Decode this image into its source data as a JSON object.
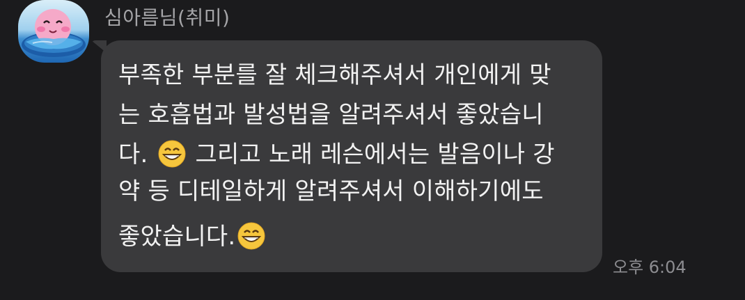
{
  "chat": {
    "sender_name": "심아름님(취미)",
    "message": {
      "line1": "부족한 부분를 잘 체크해주셔서 개인에게 맞",
      "line2": "는 호흡법과 발성법을 알려주셔서 좋았습니",
      "line3_before_emoji": "다.",
      "line3_after_emoji": "그리고 노래 레슨에서는 발음이나 강",
      "line4": "약 등 디테일하게 알려주셔서 이해하기에도",
      "line5": "좋았습니다."
    },
    "timestamp": "오후 6:04",
    "avatar_icon": "kirby-avatar-icon",
    "emoji_icon": "grinning-face-with-smiling-eyes-icon"
  }
}
